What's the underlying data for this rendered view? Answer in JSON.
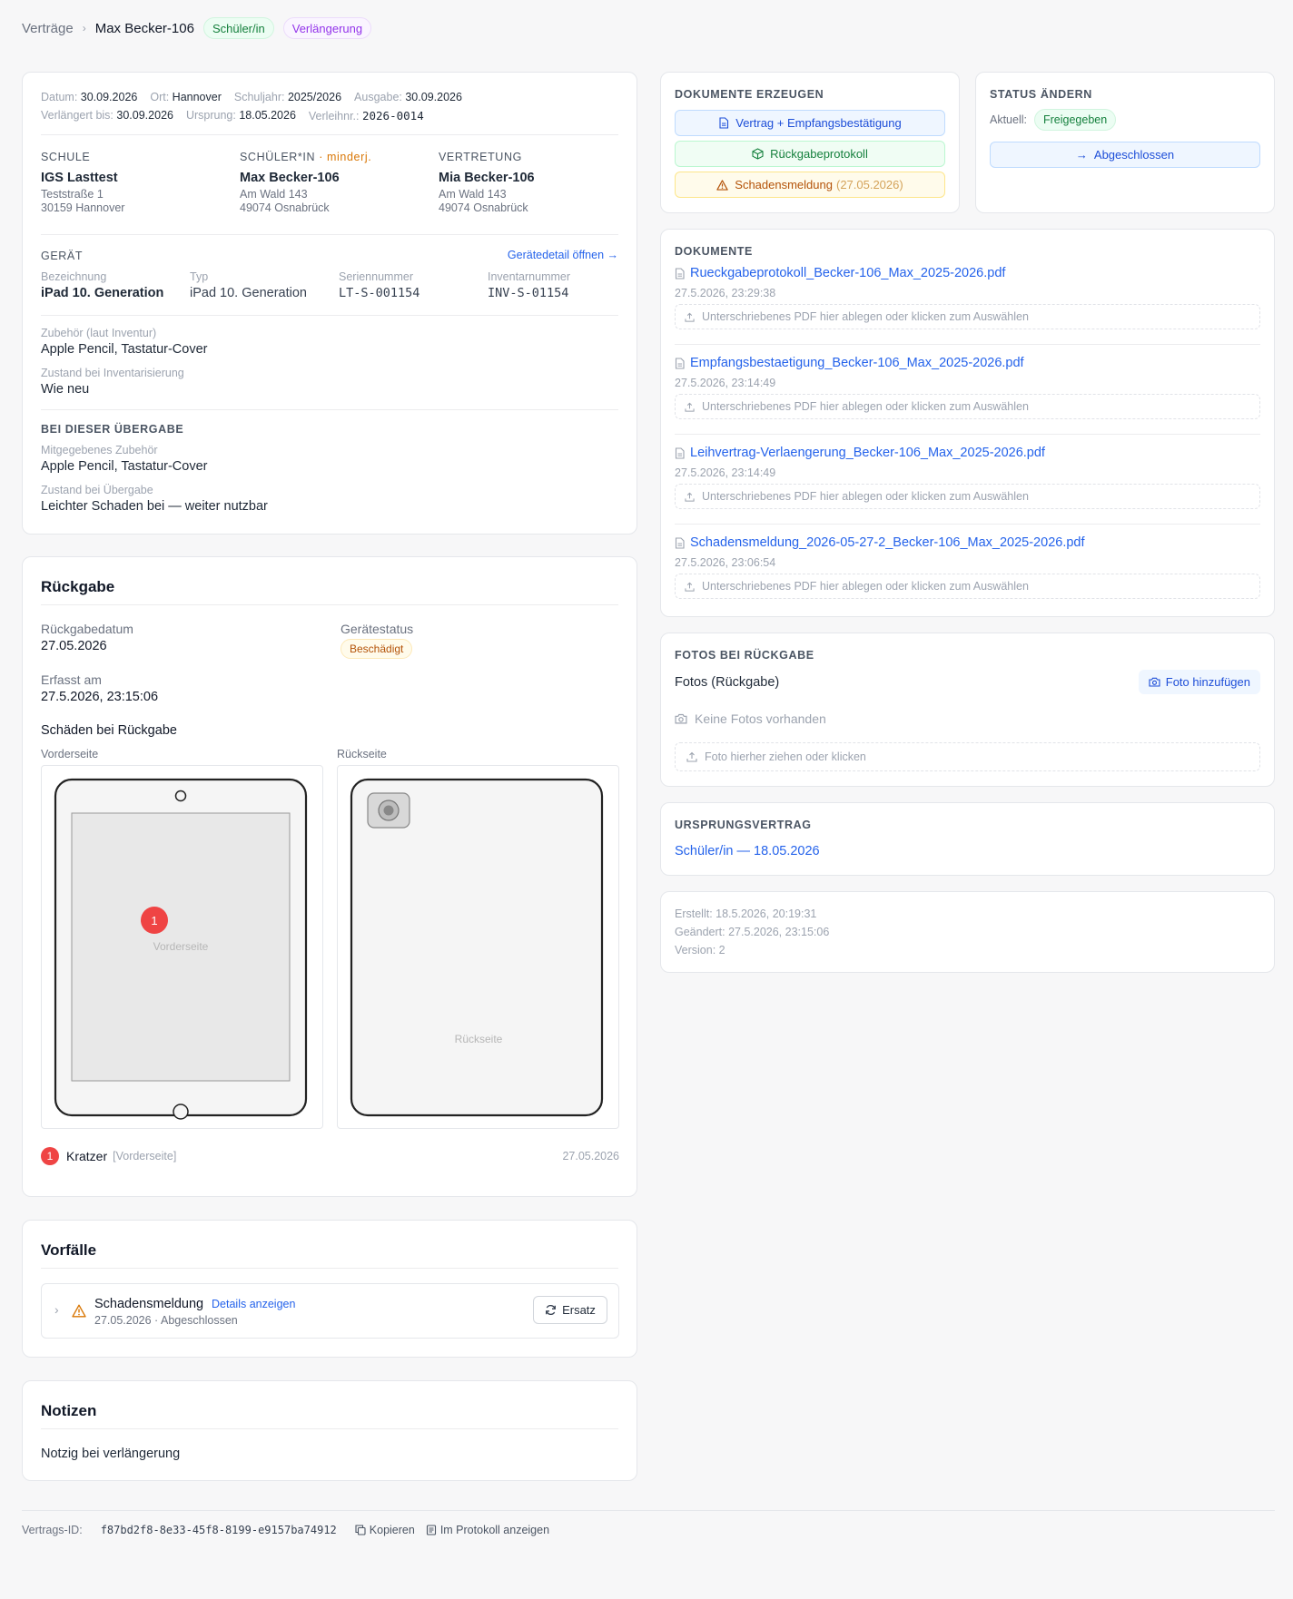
{
  "breadcrumb": {
    "parent": "Verträge",
    "current": "Max Becker-106",
    "badge_type": "Schüler/in",
    "badge_kind": "Verlängerung"
  },
  "contract": {
    "meta": {
      "date_label": "Datum:",
      "date": "30.09.2026",
      "place_label": "Ort:",
      "place": "Hannover",
      "year_label": "Schuljahr:",
      "year": "2025/2026",
      "issue_label": "Ausgabe:",
      "issue": "30.09.2026",
      "ext_label": "Verlängert bis:",
      "ext": "30.09.2026",
      "origin_label": "Ursprung:",
      "origin": "18.05.2026",
      "loan_label": "Verleihnr.:",
      "loan": "2026-0014"
    },
    "school": {
      "head": "SCHULE",
      "name": "IGS Lasttest",
      "street": "Teststraße 1",
      "city": "30159 Hannover"
    },
    "student": {
      "head": "SCHÜLER*IN",
      "minor": "· minderj.",
      "name": "Max Becker-106",
      "street": "Am Wald 143",
      "city": "49074 Osnabrück"
    },
    "rep": {
      "head": "VERTRETUNG",
      "name": "Mia Becker-106",
      "street": "Am Wald 143",
      "city": "49074 Osnabrück"
    },
    "device": {
      "head": "GERÄT",
      "open_link": "Gerätedetail öffnen →",
      "name_label": "Bezeichnung",
      "name": "iPad 10. Generation",
      "type_label": "Typ",
      "type": "iPad 10. Generation",
      "serial_label": "Seriennummer",
      "serial": "LT-S-001154",
      "inv_label": "Inventarnummer",
      "inv": "INV-S-01154",
      "acc_label": "Zubehör (laut Inventur)",
      "acc": "Apple Pencil, Tastatur-Cover",
      "cond_label": "Zustand bei Inventarisierung",
      "cond": "Wie neu"
    },
    "handover": {
      "head": "BEI DIESER ÜBERGABE",
      "acc_label": "Mitgegebenes Zubehör",
      "acc": "Apple Pencil, Tastatur-Cover",
      "cond_label": "Zustand bei Übergabe",
      "cond": "Leichter Schaden bei — weiter nutzbar"
    }
  },
  "return": {
    "title": "Rückgabe",
    "date_label": "Rückgabedatum",
    "date": "27.05.2026",
    "status_label": "Gerätestatus",
    "status": "Beschädigt",
    "captured_label": "Erfasst am",
    "captured": "27.5.2026, 23:15:06",
    "damage_title": "Schäden bei Rückgabe",
    "front_label": "Vorderseite",
    "back_label": "Rückseite",
    "front_watermark": "Vorderseite",
    "back_watermark": "Rückseite",
    "marker_number": "1",
    "damage": {
      "number": "1",
      "name": "Kratzer",
      "side": "[Vorderseite]",
      "date": "27.05.2026"
    }
  },
  "incidents": {
    "title": "Vorfälle",
    "item": {
      "name": "Schadensmeldung",
      "details_link": "Details anzeigen",
      "sub": "27.05.2026 · Abgeschlossen",
      "action": "Ersatz"
    }
  },
  "notes": {
    "title": "Notizen",
    "text": "Notzig bei verlängerung"
  },
  "footer": {
    "id_label": "Vertrags-ID:",
    "id": "f87bd2f8-8e33-45f8-8199-e9157ba74912",
    "copy": "Kopieren",
    "protocol": "Im Protokoll anzeigen"
  },
  "gen_docs": {
    "head": "DOKUMENTE ERZEUGEN",
    "btn_contract": "Vertrag + Empfangsbestätigung",
    "btn_return": "Rückgabeprotokoll",
    "btn_damage": "Schadensmeldung",
    "btn_damage_date": "(27.05.2026)"
  },
  "status_change": {
    "head": "STATUS ÄNDERN",
    "current_label": "Aktuell:",
    "current": "Freigegeben",
    "next": "Abgeschlossen"
  },
  "documents": {
    "head": "DOKUMENTE",
    "dropzone_text": "Unterschriebenes PDF hier ablegen oder klicken zum Auswählen",
    "items": [
      {
        "name": "Rueckgabeprotokoll_Becker-106_Max_2025-2026.pdf",
        "date": "27.5.2026, 23:29:38"
      },
      {
        "name": "Empfangsbestaetigung_Becker-106_Max_2025-2026.pdf",
        "date": "27.5.2026, 23:14:49"
      },
      {
        "name": "Leihvertrag-Verlaengerung_Becker-106_Max_2025-2026.pdf",
        "date": "27.5.2026, 23:14:49"
      },
      {
        "name": "Schadensmeldung_2026-05-27-2_Becker-106_Max_2025-2026.pdf",
        "date": "27.5.2026, 23:06:54"
      }
    ]
  },
  "photos": {
    "head": "FOTOS BEI RÜCKGABE",
    "title": "Fotos (Rückgabe)",
    "add": "Foto hinzufügen",
    "empty": "Keine Fotos vorhanden",
    "drop": "Foto hierher ziehen oder klicken"
  },
  "origin": {
    "head": "URSPRUNGSVERTRAG",
    "link": "Schüler/in — 18.05.2026"
  },
  "audit": {
    "created": "Erstellt: 18.5.2026, 20:19:31",
    "changed": "Geändert: 27.5.2026, 23:15:06",
    "version": "Version: 2"
  },
  "colors": {
    "accent": "#2563eb",
    "danger": "#ef4444",
    "warning": "#b45309",
    "success": "#15803d"
  }
}
